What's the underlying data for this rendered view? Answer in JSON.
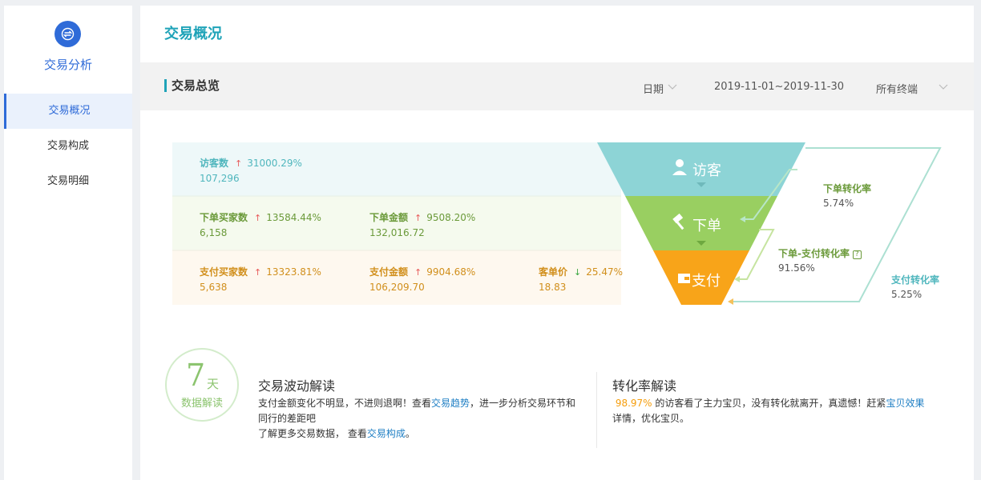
{
  "sidebar": {
    "title": "交易分析",
    "items": [
      {
        "label": "交易概况"
      },
      {
        "label": "交易构成"
      },
      {
        "label": "交易明细"
      }
    ]
  },
  "page_title": "交易概况",
  "toolbar": {
    "section_title": "交易总览",
    "date_label": "日期",
    "date_range": "2019-11-01~2019-11-30",
    "terminal": "所有终端"
  },
  "funnel": {
    "visitor": {
      "stage": "访客",
      "metrics": [
        {
          "label": "访客数",
          "pct": "31000.29%",
          "value": "107,296",
          "trend": "up"
        }
      ]
    },
    "order": {
      "stage": "下单",
      "metrics": [
        {
          "label": "下单买家数",
          "pct": "13584.44%",
          "value": "6,158",
          "trend": "up"
        },
        {
          "label": "下单金额",
          "pct": "9508.20%",
          "value": "132,016.72",
          "trend": "up"
        }
      ]
    },
    "pay": {
      "stage": "支付",
      "metrics": [
        {
          "label": "支付买家数",
          "pct": "13323.81%",
          "value": "5,638",
          "trend": "up"
        },
        {
          "label": "支付金额",
          "pct": "9904.68%",
          "value": "106,209.70",
          "trend": "up"
        },
        {
          "label": "客单价",
          "pct": "25.47%",
          "value": "18.83",
          "trend": "down"
        }
      ]
    },
    "conversions": [
      {
        "name": "下单转化率",
        "value": "5.74%"
      },
      {
        "name": "下单-支付转化率",
        "value": "91.56%"
      },
      {
        "name": "支付转化率",
        "value": "5.25%"
      }
    ]
  },
  "insight_badge": {
    "number": "7",
    "unit": "天",
    "sub": "数据解读"
  },
  "fluctuation": {
    "title": "交易波动解读",
    "line1_a": "支付金额变化不明显，不进则退啊！查看",
    "line1_link": "交易趋势",
    "line1_b": "，进一步分析交易环节和",
    "line2": "同行的差距吧",
    "line3_a": "了解更多交易数据， 查看",
    "line3_link": "交易构成",
    "line3_b": "。"
  },
  "conversion": {
    "title": "转化率解读",
    "pct": "98.97%",
    "text_a": "的访客看了主力宝贝，没有转化就离开，真遗憾！赶紧",
    "link": "宝贝效果",
    "text_b": "详情，优化宝贝。"
  },
  "colors": {
    "accent": "#1fa3b8",
    "brand_blue": "#2f6bd8",
    "visitor_teal": "#8dd4d6",
    "order_green": "#99cf61",
    "pay_orange": "#f8a419",
    "link": "#1f7fc4"
  },
  "icons": {
    "logo": "exchange-icon",
    "visitor": "user-icon",
    "order": "hammer-icon",
    "pay": "wallet-icon",
    "help": "question-icon"
  }
}
